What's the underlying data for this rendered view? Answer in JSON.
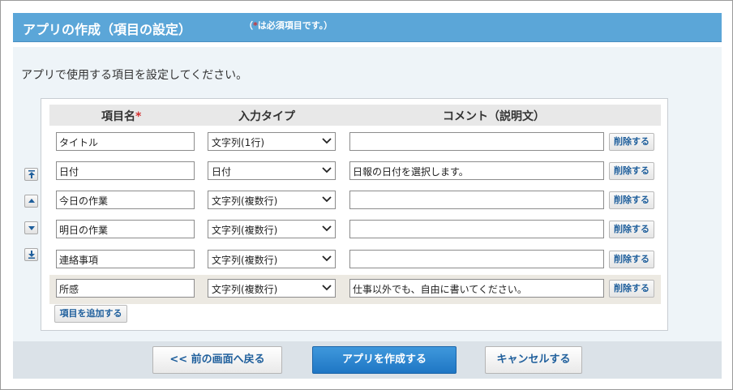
{
  "header": {
    "title": "アプリの作成（項目の設定）",
    "note_open": "（",
    "note_req_mark": "*",
    "note_text": "は必須項目です。）"
  },
  "description": "アプリで使用する項目を設定してください。",
  "table": {
    "col_name": "項目名",
    "col_name_required_mark": "*",
    "col_type": "入力タイプ",
    "col_comment": "コメント（説明文）",
    "rows": [
      {
        "name": "タイトル",
        "type": "文字列(1行)",
        "comment": "",
        "delete_label": "削除する",
        "highlighted": false
      },
      {
        "name": "日付",
        "type": "日付",
        "comment": "日報の日付を選択します。",
        "delete_label": "削除する",
        "highlighted": false
      },
      {
        "name": "今日の作業",
        "type": "文字列(複数行)",
        "comment": "",
        "delete_label": "削除する",
        "highlighted": false
      },
      {
        "name": "明日の作業",
        "type": "文字列(複数行)",
        "comment": "",
        "delete_label": "削除する",
        "highlighted": false
      },
      {
        "name": "連絡事項",
        "type": "文字列(複数行)",
        "comment": "",
        "delete_label": "削除する",
        "highlighted": false
      },
      {
        "name": "所感",
        "type": "文字列(複数行)",
        "comment": "仕事以外でも、自由に書いてください。",
        "delete_label": "削除する",
        "highlighted": true
      }
    ],
    "add_item_label": "項目を追加する"
  },
  "move_buttons": [
    "move-top-icon",
    "move-up-icon",
    "move-down-icon",
    "move-bottom-icon"
  ],
  "footer": {
    "back_label": "<< 前の画面へ戻る",
    "create_label": "アプリを作成する",
    "cancel_label": "キャンセルする"
  },
  "colors": {
    "header_bg": "#5ba6d8",
    "panel_bg": "#eef4f8",
    "footer_bg": "#dbe2e8",
    "primary_button": "#2a84d0",
    "required_mark": "#d32f2f",
    "highlight_row": "#ece9e2"
  }
}
